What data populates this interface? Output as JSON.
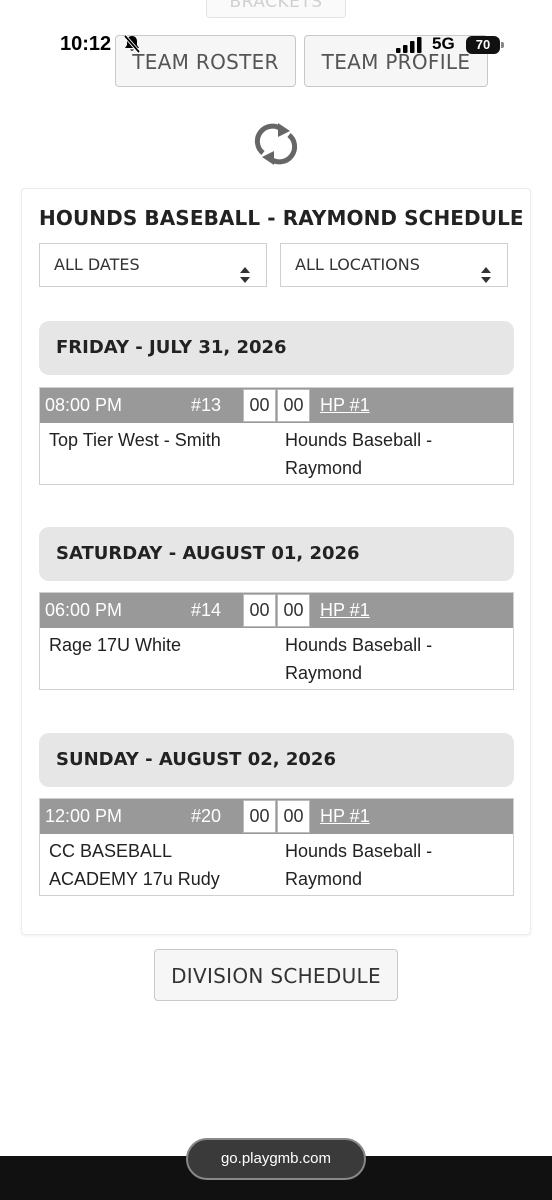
{
  "status": {
    "time": "10:12",
    "network": "5G",
    "battery": "70"
  },
  "top": {
    "brackets_label": "BRACKETS",
    "roster_label": "TEAM ROSTER",
    "profile_label": "TEAM PROFILE"
  },
  "schedule": {
    "title": "HOUNDS BASEBALL - RAYMOND SCHEDULE",
    "dates_filter": "ALL DATES",
    "locations_filter": "ALL LOCATIONS",
    "days": [
      {
        "header": "FRIDAY - JULY 31, 2026",
        "game": {
          "time": "08:00 PM",
          "number": "#13",
          "score_away": "00",
          "score_home": "00",
          "location": "HP #1",
          "away_team": "Top Tier West - Smith",
          "home_team": "Hounds Baseball - Raymond"
        }
      },
      {
        "header": "SATURDAY - AUGUST 01, 2026",
        "game": {
          "time": "06:00 PM",
          "number": "#14",
          "score_away": "00",
          "score_home": "00",
          "location": "HP #1",
          "away_team": "Rage 17U White",
          "home_team": "Hounds Baseball - Raymond"
        }
      },
      {
        "header": "SUNDAY - AUGUST 02, 2026",
        "game": {
          "time": "12:00 PM",
          "number": "#20",
          "score_away": "00",
          "score_home": "00",
          "location": "HP #1",
          "away_team": "CC BASEBALL ACADEMY 17u Rudy",
          "home_team": "Hounds Baseball - Raymond"
        }
      }
    ]
  },
  "division_button": "DIVISION SCHEDULE",
  "browser": {
    "url": "go.playgmb.com"
  },
  "icons": {
    "refresh": "refresh-icon",
    "select_arrows": "sort-arrows-icon",
    "bell_muted": "bell-slash-icon",
    "signal": "signal-bars-icon"
  }
}
